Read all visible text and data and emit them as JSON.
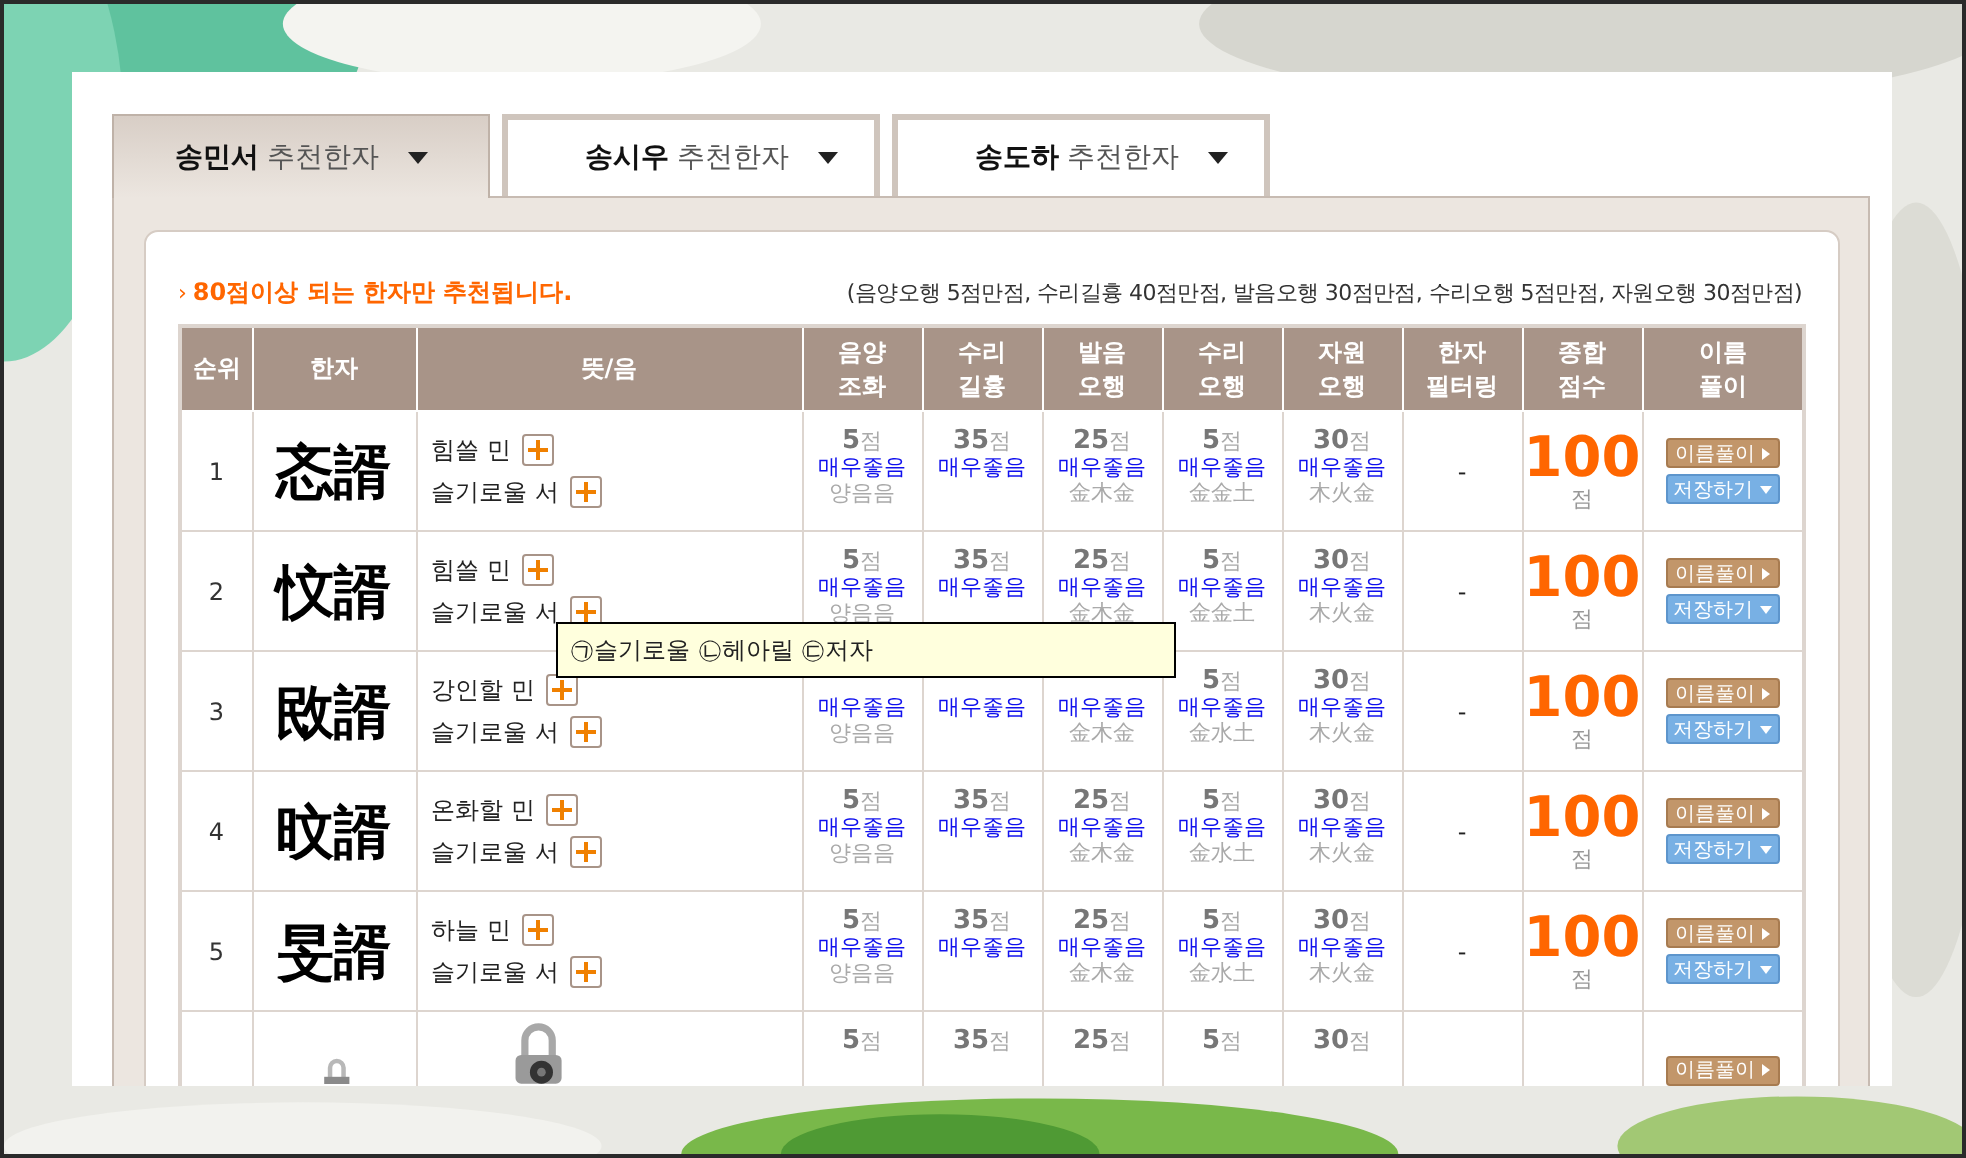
{
  "tabs": [
    {
      "label": "**송민서** 추천한자",
      "selected": true
    },
    {
      "label": "**송시우** 추천한자",
      "selected": false
    },
    {
      "label": "**송도하** 추천한자",
      "selected": false
    }
  ],
  "notice": {
    "marker": "›",
    "text": "80점이상 되는 한자만 추천됩니다.",
    "max_scores": "(음양오행 5점만점, 수리길흉 40점만점, 발음오행 30점만점, 수리오행 5점만점, 자원오행 30점만점)"
  },
  "table": {
    "columns": [
      "순위",
      "한자",
      "뜻/음",
      "음양\n조화",
      "수리\n길흉",
      "발음\n오행",
      "수리\n오행",
      "자원\n오행",
      "한자\n필터링",
      "종합\n점수",
      "이름\n풀이"
    ],
    "rows": [
      {
        "rank": "1",
        "hanja": {
          "kind": "text",
          "text": "忞諝"
        },
        "meanings": {
          "kind": "text",
          "items": [
            "힘쓸 민",
            "슬기로울 서"
          ]
        },
        "scores": [
          {
            "points": "**5**점",
            "grade": "매우좋음",
            "element": "양음음"
          },
          {
            "points": "**35**점",
            "grade": "매우좋음"
          },
          {
            "points": "**25**점",
            "grade": "매우좋음",
            "element": "金木金"
          },
          {
            "points": "**5**점",
            "grade": "매우좋음",
            "element": "金金土"
          },
          {
            "points": "**30**점",
            "grade": "매우좋음",
            "element": "木火金"
          }
        ],
        "filter": "-",
        "total": "100",
        "total_unit": "점",
        "buttons": [
          {
            "kind": "detail",
            "label": "이름풀이"
          },
          {
            "kind": "save",
            "label": "저장하기"
          }
        ]
      },
      {
        "rank": "2",
        "hanja": {
          "kind": "text",
          "text": "忟諝"
        },
        "meanings": {
          "kind": "text",
          "items": [
            "힘쓸 민",
            "슬기로울 서"
          ]
        },
        "scores": [
          {
            "points": "**5**점",
            "grade": "매우좋음",
            "element": "양음음"
          },
          {
            "points": "**35**점",
            "grade": "매우좋음"
          },
          {
            "points": "**25**점",
            "grade": "매우좋음",
            "element": "金木金"
          },
          {
            "points": "**5**점",
            "grade": "매우좋음",
            "element": "金金土"
          },
          {
            "points": "**30**점",
            "grade": "매우좋음",
            "element": "木火金"
          }
        ],
        "filter": "-",
        "total": "100",
        "total_unit": "점",
        "buttons": [
          {
            "kind": "detail",
            "label": "이름풀이"
          },
          {
            "kind": "save",
            "label": "저장하기"
          }
        ]
      },
      {
        "rank": "3",
        "hanja": {
          "kind": "text",
          "text": "敃諝"
        },
        "meanings": {
          "kind": "text",
          "items": [
            "강인할 민",
            "슬기로울 서"
          ]
        },
        "scores": [
          {
            "grade": "매우좋음",
            "element": "양음음"
          },
          {
            "grade": "매우좋음"
          },
          {
            "grade": "매우좋음",
            "element": "金木金"
          },
          {
            "points": "**5**점",
            "grade": "매우좋음",
            "element": "金水土"
          },
          {
            "points": "**30**점",
            "grade": "매우좋음",
            "element": "木火金"
          }
        ],
        "filter": "-",
        "total": "100",
        "total_unit": "점",
        "buttons": [
          {
            "kind": "detail",
            "label": "이름풀이"
          },
          {
            "kind": "save",
            "label": "저장하기"
          }
        ]
      },
      {
        "rank": "4",
        "hanja": {
          "kind": "text",
          "text": "旼諝"
        },
        "meanings": {
          "kind": "text",
          "items": [
            "온화할 민",
            "슬기로울 서"
          ]
        },
        "scores": [
          {
            "points": "**5**점",
            "grade": "매우좋음",
            "element": "양음음"
          },
          {
            "points": "**35**점",
            "grade": "매우좋음"
          },
          {
            "points": "**25**점",
            "grade": "매우좋음",
            "element": "金木金"
          },
          {
            "points": "**5**점",
            "grade": "매우좋음",
            "element": "金水土"
          },
          {
            "points": "**30**점",
            "grade": "매우좋음",
            "element": "木火金"
          }
        ],
        "filter": "-",
        "total": "100",
        "total_unit": "점",
        "buttons": [
          {
            "kind": "detail",
            "label": "이름풀이"
          },
          {
            "kind": "save",
            "label": "저장하기"
          }
        ]
      },
      {
        "rank": "5",
        "hanja": {
          "kind": "text",
          "text": "旻諝"
        },
        "meanings": {
          "kind": "text",
          "items": [
            "하늘 민",
            "슬기로울 서"
          ]
        },
        "scores": [
          {
            "points": "**5**점",
            "grade": "매우좋음",
            "element": "양음음"
          },
          {
            "points": "**35**점",
            "grade": "매우좋음"
          },
          {
            "points": "**25**점",
            "grade": "매우좋음",
            "element": "金木金"
          },
          {
            "points": "**5**점",
            "grade": "매우좋음",
            "element": "金水土"
          },
          {
            "points": "**30**점",
            "grade": "매우좋음",
            "element": "木火金"
          }
        ],
        "filter": "-",
        "total": "100",
        "total_unit": "점",
        "buttons": [
          {
            "kind": "detail",
            "label": "이름풀이"
          },
          {
            "kind": "save",
            "label": "저장하기"
          }
        ]
      },
      {
        "hanja": {
          "kind": "picture"
        },
        "meanings": {
          "kind": "picture"
        },
        "scores": [
          {
            "points": "**5**점"
          },
          {
            "points": "**35**점"
          },
          {
            "points": "**25**점"
          },
          {
            "points": "**5**점"
          },
          {
            "points": "**30**점"
          }
        ],
        "buttons": [
          {
            "kind": "detail",
            "label": "이름풀이"
          }
        ]
      }
    ]
  },
  "tooltip": {
    "text": "㉠슬기로울 ㉡헤아릴 ㉢저자"
  }
}
